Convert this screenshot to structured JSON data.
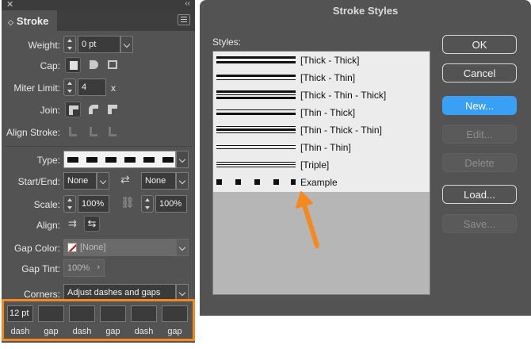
{
  "panel": {
    "tab_title": "Stroke",
    "weight_label": "Weight:",
    "weight_value": "0 pt",
    "cap_label": "Cap:",
    "miter_label": "Miter Limit:",
    "miter_value": "4",
    "miter_suffix": "x",
    "join_label": "Join:",
    "align_stroke_label": "Align Stroke:",
    "type_label": "Type:",
    "start_end_label": "Start/End:",
    "start_value": "None",
    "end_value": "None",
    "scale_label": "Scale:",
    "scale_start": "100%",
    "scale_end": "100%",
    "align_label": "Align:",
    "gap_color_label": "Gap Color:",
    "gap_color_value": "[None]",
    "gap_tint_label": "Gap Tint:",
    "gap_tint_value": "100%",
    "corners_label": "Corners:",
    "corners_value": "Adjust dashes and gaps",
    "dash_fields": [
      {
        "value": "12 pt",
        "label": "dash"
      },
      {
        "value": "",
        "label": "gap"
      },
      {
        "value": "",
        "label": "dash"
      },
      {
        "value": "",
        "label": "gap"
      },
      {
        "value": "",
        "label": "dash"
      },
      {
        "value": "",
        "label": "gap"
      }
    ],
    "highlight_color": "#f5891f"
  },
  "dialog": {
    "title": "Stroke Styles",
    "styles_label": "Styles:",
    "styles": [
      {
        "name": "[Thick - Thick]"
      },
      {
        "name": "[Thick - Thin]"
      },
      {
        "name": "[Thick - Thin - Thick]"
      },
      {
        "name": "[Thin - Thick]"
      },
      {
        "name": "[Thin - Thick - Thin]"
      },
      {
        "name": "[Thin - Thin]"
      },
      {
        "name": "[Triple]"
      },
      {
        "name": "Example"
      }
    ],
    "buttons": {
      "ok": "OK",
      "cancel": "Cancel",
      "new": "New...",
      "edit": "Edit...",
      "delete": "Delete",
      "load": "Load...",
      "save": "Save..."
    },
    "accent_color": "#3aa0f5",
    "arrow_color": "#f5891f"
  }
}
